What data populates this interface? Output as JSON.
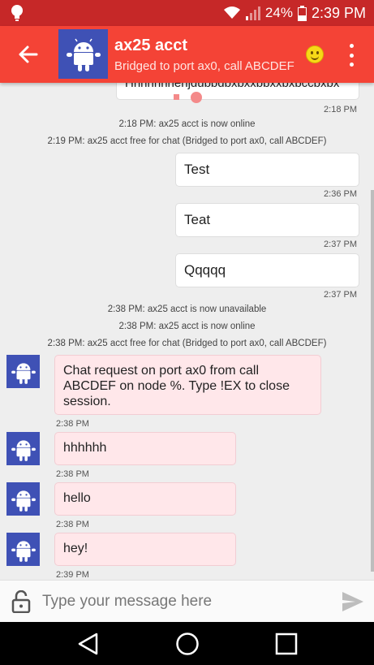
{
  "status_bar": {
    "battery": "24%",
    "time": "2:39 PM"
  },
  "header": {
    "title": "ax25 acct",
    "subtitle": "Bridged to port ax0, call ABCDEF"
  },
  "messages": {
    "cut_text": "Hhhhhhhehjdubbdbxbxxbbxxbxbccbxbx",
    "cut_time": "2:18 PM",
    "sys1": "2:18 PM: ax25 acct is now online",
    "sys2": "2:19 PM: ax25 acct free for chat (Bridged to port ax0, call ABCDEF)",
    "out1": {
      "text": "Test",
      "time": "2:36 PM"
    },
    "out2": {
      "text": "Teat",
      "time": "2:37 PM"
    },
    "out3": {
      "text": "Qqqqq",
      "time": "2:37 PM"
    },
    "sys3": "2:38 PM: ax25 acct is now unavailable",
    "sys4": "2:38 PM: ax25 acct is now online",
    "sys5": "2:38 PM: ax25 acct free for chat (Bridged to port ax0, call ABCDEF)",
    "in1": {
      "text": "Chat request on port ax0 from call ABCDEF on node %.  Type !EX to close session.",
      "time": "2:38 PM"
    },
    "in2": {
      "text": "hhhhhh",
      "time": "2:38 PM"
    },
    "in3": {
      "text": "hello",
      "time": "2:38 PM"
    },
    "in4": {
      "text": "hey!",
      "time": "2:39 PM"
    }
  },
  "composer": {
    "placeholder": "Type your message here"
  },
  "colors": {
    "status_bar": "#c62828",
    "app_bar": "#f44336",
    "avatar": "#3f51b5",
    "incoming_bubble": "#ffe7ea"
  }
}
